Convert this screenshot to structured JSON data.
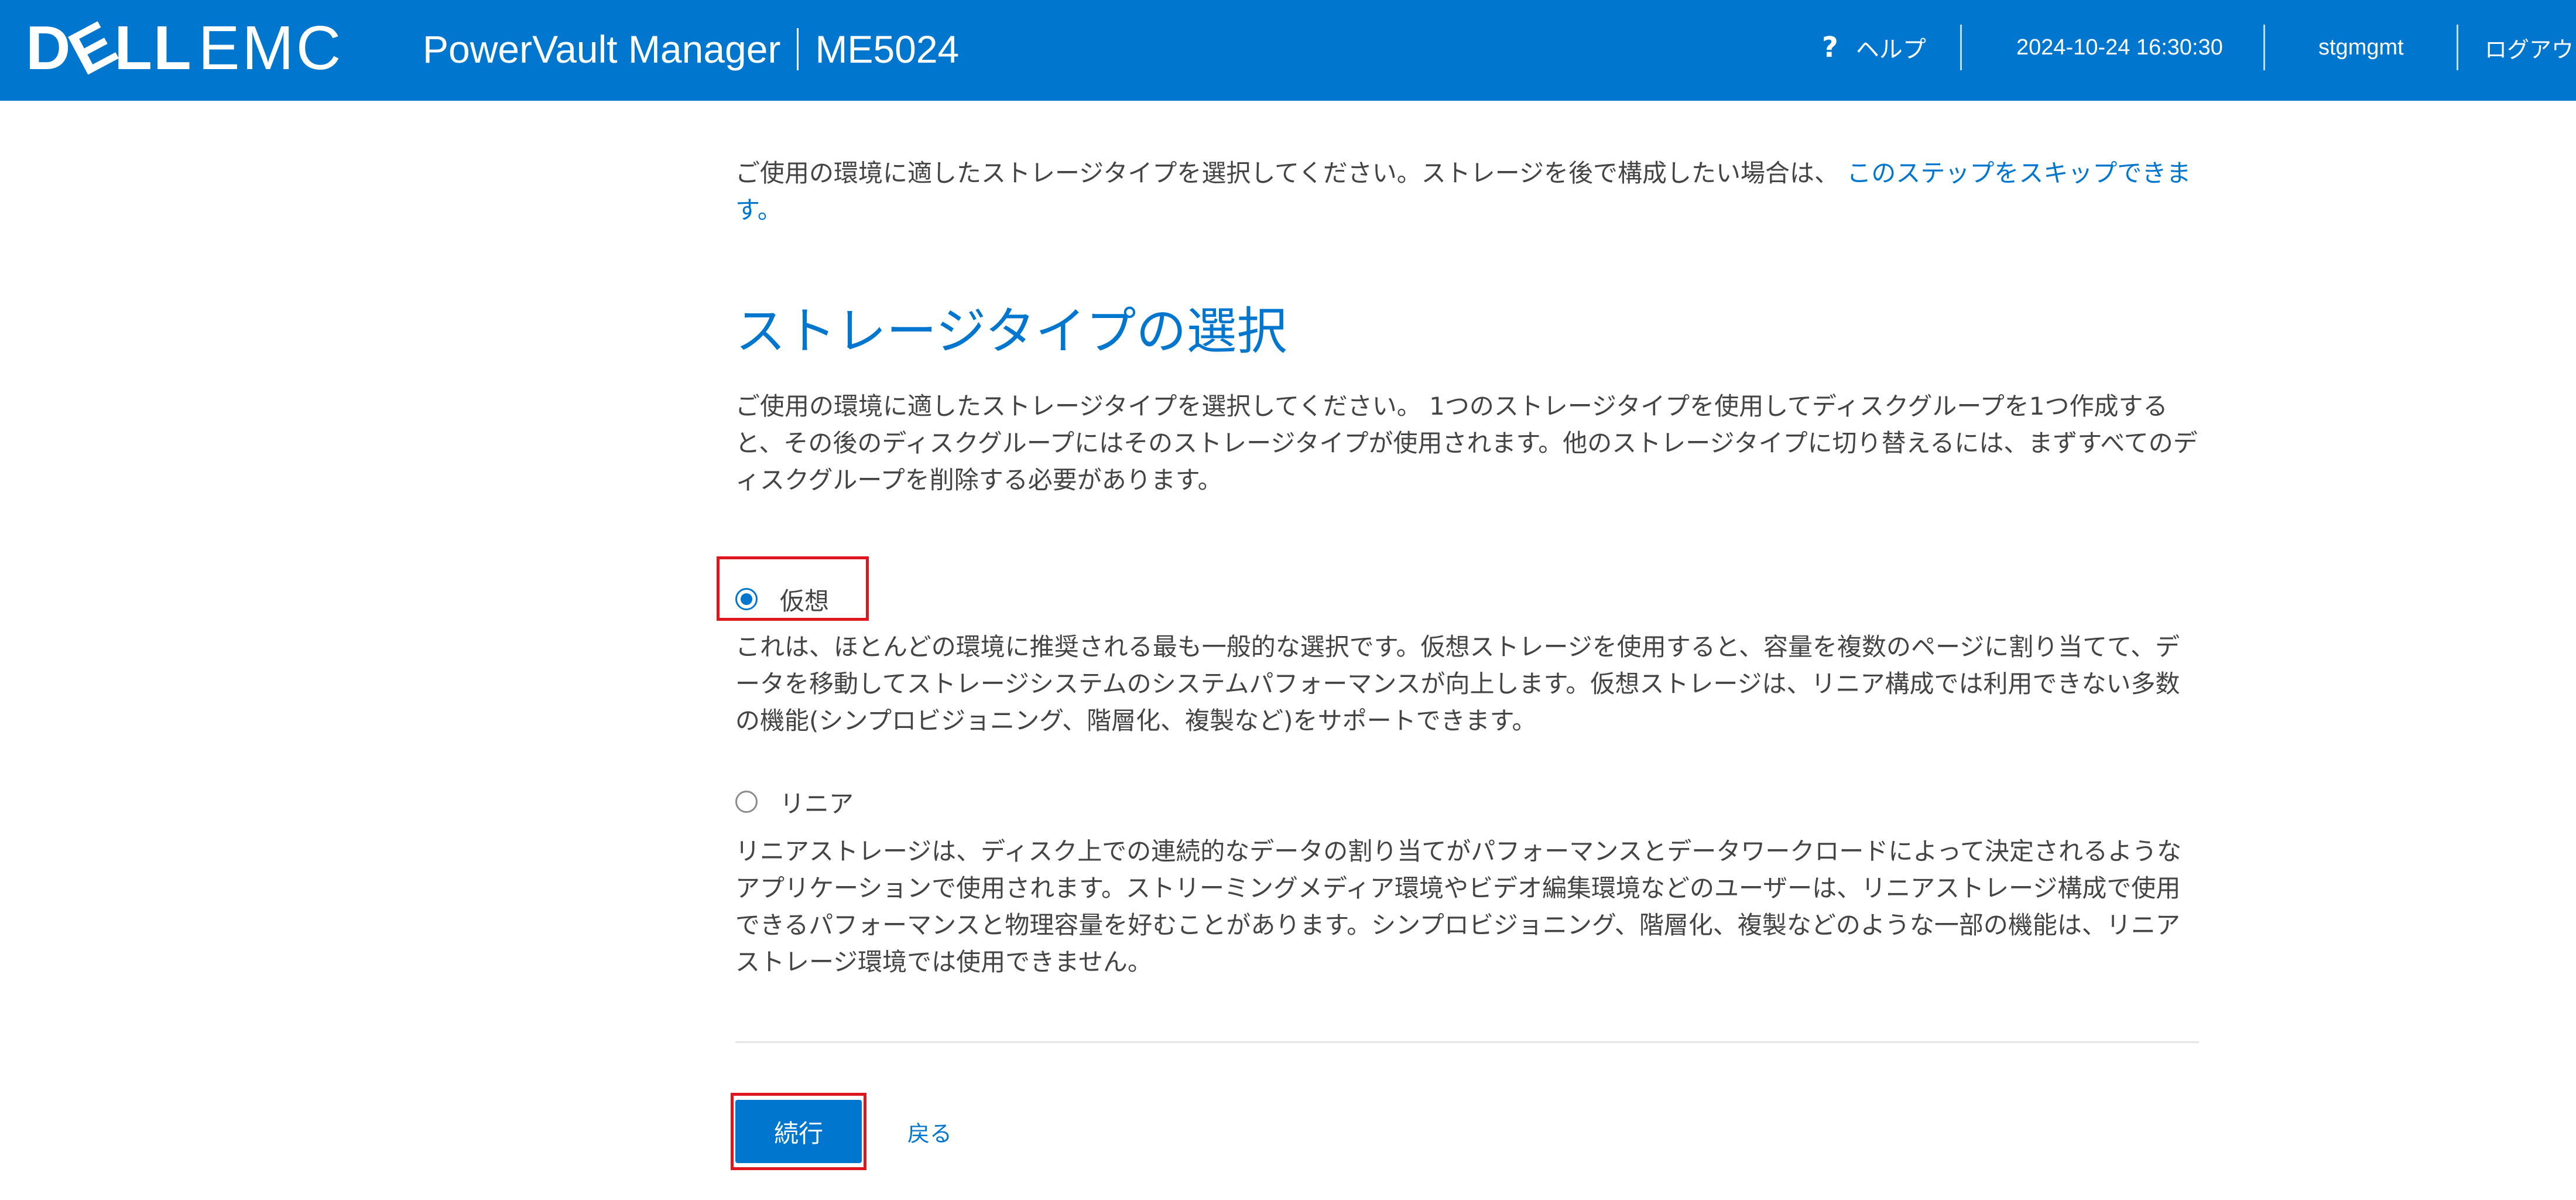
{
  "header": {
    "logo_dell": "DELL",
    "logo_emc": "EMC",
    "product_name": "PowerVault Manager",
    "model": "ME5024",
    "help_icon": "?",
    "help_label": "ヘルプ",
    "datetime": "2024-10-24 16:30:30",
    "username": "stgmgmt",
    "logout_label": "ログアウ",
    "background_color": "#0076ce"
  },
  "intro": {
    "text": "ご使用の環境に適したストレージタイプを選択してください。ストレージを後で構成したい場合は、",
    "skip_link": "このステップをスキップできます。"
  },
  "section": {
    "title": "ストレージタイプの選択",
    "description": "ご使用の環境に適したストレージタイプを選択してください。 1つのストレージタイプを使用してディスクグループを1つ作成すると、その後のディスクグループにはそのストレージタイプが使用されます。他のストレージタイプに切り替えるには、まずすべてのディスクグループを削除する必要があります。"
  },
  "options": [
    {
      "label": "仮想",
      "selected": true,
      "description": "これは、ほとんどの環境に推奨される最も一般的な選択です。仮想ストレージを使用すると、容量を複数のページに割り当てて、データを移動してストレージシステムのシステムパフォーマンスが向上します。仮想ストレージは、リニア構成では利用できない多数の機能(シンプロビジョニング、階層化、複製など)をサポートできます。"
    },
    {
      "label": "リニア",
      "selected": false,
      "description": "リニアストレージは、ディスク上での連続的なデータの割り当てがパフォーマンスとデータワークロードによって決定されるようなアプリケーションで使用されます。ストリーミングメディア環境やビデオ編集環境などのユーザーは、リニアストレージ構成で使用できるパフォーマンスと物理容量を好むことがあります。シンプロビジョニング、階層化、複製などのような一部の機能は、リニアストレージ環境では使用できません。"
    }
  ],
  "actions": {
    "continue_label": "続行",
    "back_label": "戻る"
  },
  "colors": {
    "accent": "#0076ce",
    "highlight": "#e0161e",
    "text": "#444444"
  }
}
